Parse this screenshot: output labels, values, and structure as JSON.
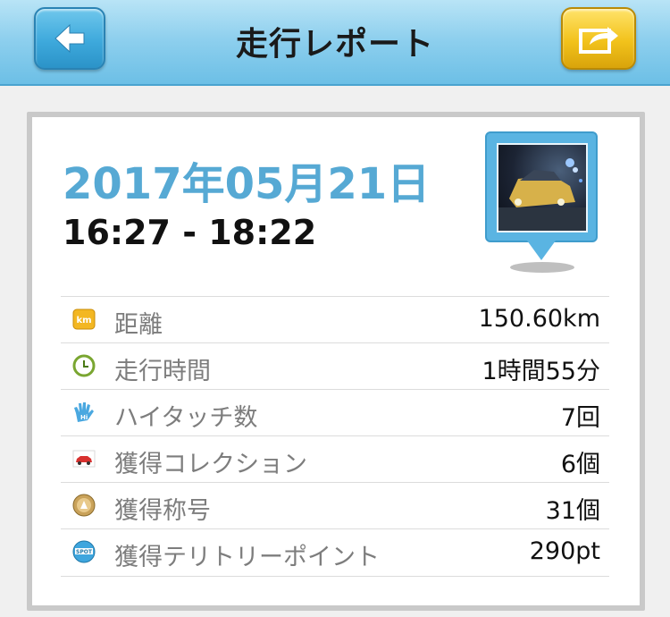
{
  "header": {
    "title": "走行レポート",
    "back_icon": "arrow-left-icon",
    "share_icon": "share-icon"
  },
  "report": {
    "date": "2017年05月21日",
    "time_range": "16:27 - 18:22",
    "photo_icon": "photo-thumbnail"
  },
  "stats": [
    {
      "icon": "km-badge-icon",
      "label": "距離",
      "value": "150.60km"
    },
    {
      "icon": "clock-icon",
      "label": "走行時間",
      "value": "1時間55分"
    },
    {
      "icon": "hand-hi-icon",
      "label": "ハイタッチ数",
      "value": "7回"
    },
    {
      "icon": "car-card-icon",
      "label": "獲得コレクション",
      "value": "6個"
    },
    {
      "icon": "medal-icon",
      "label": "獲得称号",
      "value": "31個"
    },
    {
      "icon": "spot-badge-icon",
      "label": "獲得テリトリーポイント",
      "value": "290pt"
    }
  ],
  "colors": {
    "header_blue": "#8fd0ee",
    "date_blue": "#56a9d4",
    "share_gold": "#f2c21b",
    "label_gray": "#7d7d7d"
  }
}
